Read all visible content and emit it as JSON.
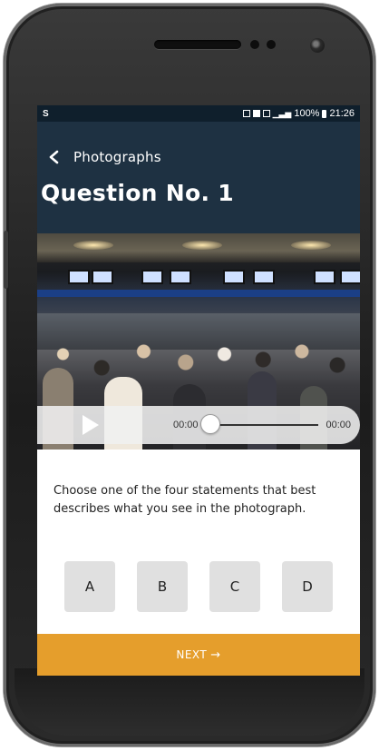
{
  "status_bar": {
    "left_icon": "S",
    "battery": "100%",
    "time": "21:26"
  },
  "header": {
    "back_label": "Photographs",
    "title": "Question No. 1"
  },
  "audio": {
    "current_time": "00:00",
    "total_time": "00:00",
    "progress": 0
  },
  "question": {
    "text": "Choose one of the four statements that best describes what you see in the photograph."
  },
  "options": [
    "A",
    "B",
    "C",
    "D"
  ],
  "next_button": {
    "label": "NEXT",
    "arrow": "→"
  },
  "colors": {
    "header_bg": "#1e3142",
    "status_bg": "#0f1f2c",
    "accent": "#e59e2c",
    "option_bg": "#e0e0e0"
  }
}
